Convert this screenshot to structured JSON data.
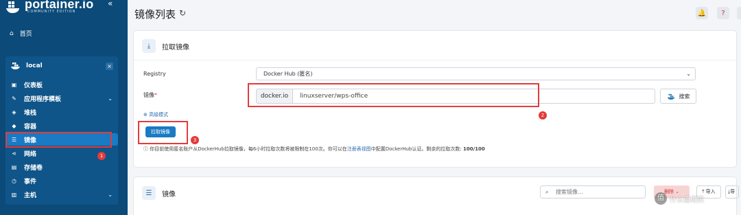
{
  "brand": {
    "name": "portainer.io",
    "edition": "COMMUNITY EDITION"
  },
  "sidebar": {
    "collapse_icon": "«",
    "home": "首页",
    "environment": "local",
    "close": "×",
    "items": [
      {
        "label": "仪表板",
        "icon": "dashboard-icon"
      },
      {
        "label": "应用程序模板",
        "icon": "templates-icon"
      },
      {
        "label": "堆栈",
        "icon": "stacks-icon"
      },
      {
        "label": "容器",
        "icon": "containers-icon"
      },
      {
        "label": "镜像",
        "icon": "images-icon"
      },
      {
        "label": "网络",
        "icon": "network-icon"
      },
      {
        "label": "存储卷",
        "icon": "volumes-icon"
      },
      {
        "label": "事件",
        "icon": "events-icon"
      },
      {
        "label": "主机",
        "icon": "host-icon"
      }
    ]
  },
  "header": {
    "title": "镜像列表"
  },
  "pull": {
    "title": "拉取镜像",
    "registry_label": "Registry",
    "registry_value": "Docker Hub (匿名)",
    "image_label": "镜像",
    "required_mark": "*",
    "prefix": "docker.io",
    "image_value": "linuxserver/wps-office",
    "search_label": "搜索",
    "advanced": "高级模式",
    "pull_button": "拉取镜像",
    "note_prefix": "你目前使用匿名账户从DockerHub拉取镜像，每6小时拉取次数将被限制在100次。你可以在",
    "note_link": "注册表视图",
    "note_suffix": "中配置DockerHub认证。剩余的拉取次数:",
    "note_count": "100/100"
  },
  "images": {
    "title": "镜像",
    "search_placeholder": "搜索镜像...",
    "remove_label": "删除",
    "import_label": "导入",
    "export_label": "导出"
  },
  "annotations": {
    "badge1": "1",
    "badge2": "2",
    "badge3": "3",
    "red": "#e23b3b"
  },
  "watermark": {
    "text": "值 什么值得买",
    "glyph": "值"
  },
  "colors": {
    "sidebar": "#0b4a79",
    "accent": "#1a7ac4",
    "annotation": "#e23b3b"
  }
}
